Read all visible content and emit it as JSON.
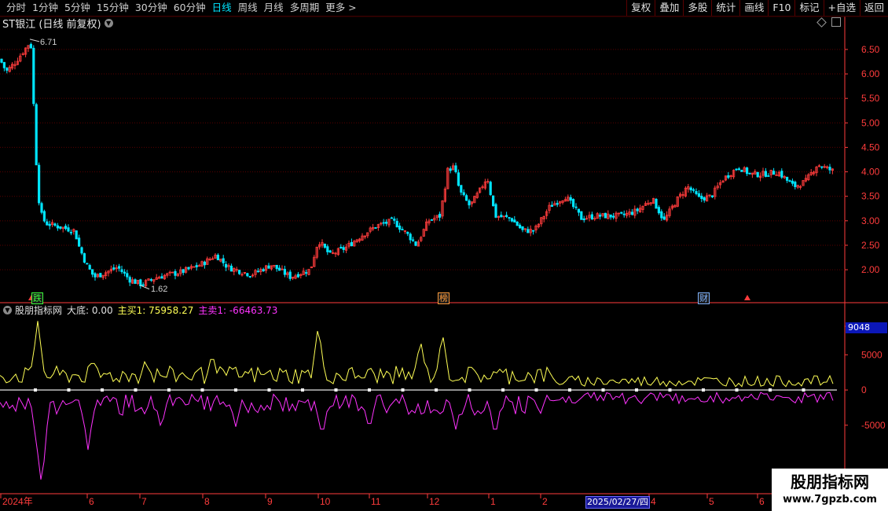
{
  "toolbar": {
    "periods": [
      {
        "label": "分时",
        "active": false
      },
      {
        "label": "1分钟",
        "active": false
      },
      {
        "label": "5分钟",
        "active": false
      },
      {
        "label": "15分钟",
        "active": false
      },
      {
        "label": "30分钟",
        "active": false
      },
      {
        "label": "60分钟",
        "active": false
      },
      {
        "label": "日线",
        "active": true
      },
      {
        "label": "周线",
        "active": false
      },
      {
        "label": "月线",
        "active": false
      },
      {
        "label": "多周期",
        "active": false
      },
      {
        "label": "更多 >",
        "active": false
      }
    ],
    "buttons": [
      "复权",
      "叠加",
      "多股",
      "统计",
      "画线",
      "F10",
      "标记",
      "+自选",
      "返回"
    ]
  },
  "price_panel": {
    "title": "ST银江 (日线 前复权)",
    "high_label": "6.71",
    "low_label": "1.62",
    "y_ticks": [
      "6.50",
      "6.00",
      "5.50",
      "5.00",
      "4.50",
      "4.00",
      "3.50",
      "3.00",
      "2.50",
      "2.00"
    ],
    "y_values": [
      6.5,
      6.0,
      5.5,
      5.0,
      4.5,
      4.0,
      3.5,
      3.0,
      2.5,
      2.0
    ],
    "tags": [
      {
        "text": "跌",
        "color": "#3cff3c"
      },
      {
        "text": "榜",
        "color": "#ff9c3c"
      },
      {
        "text": "财",
        "color": "#7fb3ff"
      }
    ]
  },
  "indicator_panel": {
    "name": "股朋指标网",
    "dadi_label": "大底: 0.00",
    "zhumai_label": "主买1: 75958.27",
    "zhumai2_label": "主卖1: -66463.73",
    "y_ticks": [
      "9048",
      "5000",
      "0",
      "-5000"
    ],
    "colors": {
      "buy": "#ffff55",
      "sell": "#ff33ff"
    }
  },
  "time_axis": {
    "labels": [
      "2024年",
      "6",
      "7",
      "8",
      "9",
      "10",
      "11",
      "12",
      "1",
      "2",
      "4",
      "5",
      "6"
    ],
    "cursor_date": "2025/02/27/四"
  },
  "watermark": {
    "line1": "股朋指标网",
    "line2": "www.7gpzb.com"
  },
  "colors": {
    "up": "#ff3c3c",
    "down": "#00e5ff",
    "grid": "#5a0000",
    "axis": "#ff3c3c"
  }
}
